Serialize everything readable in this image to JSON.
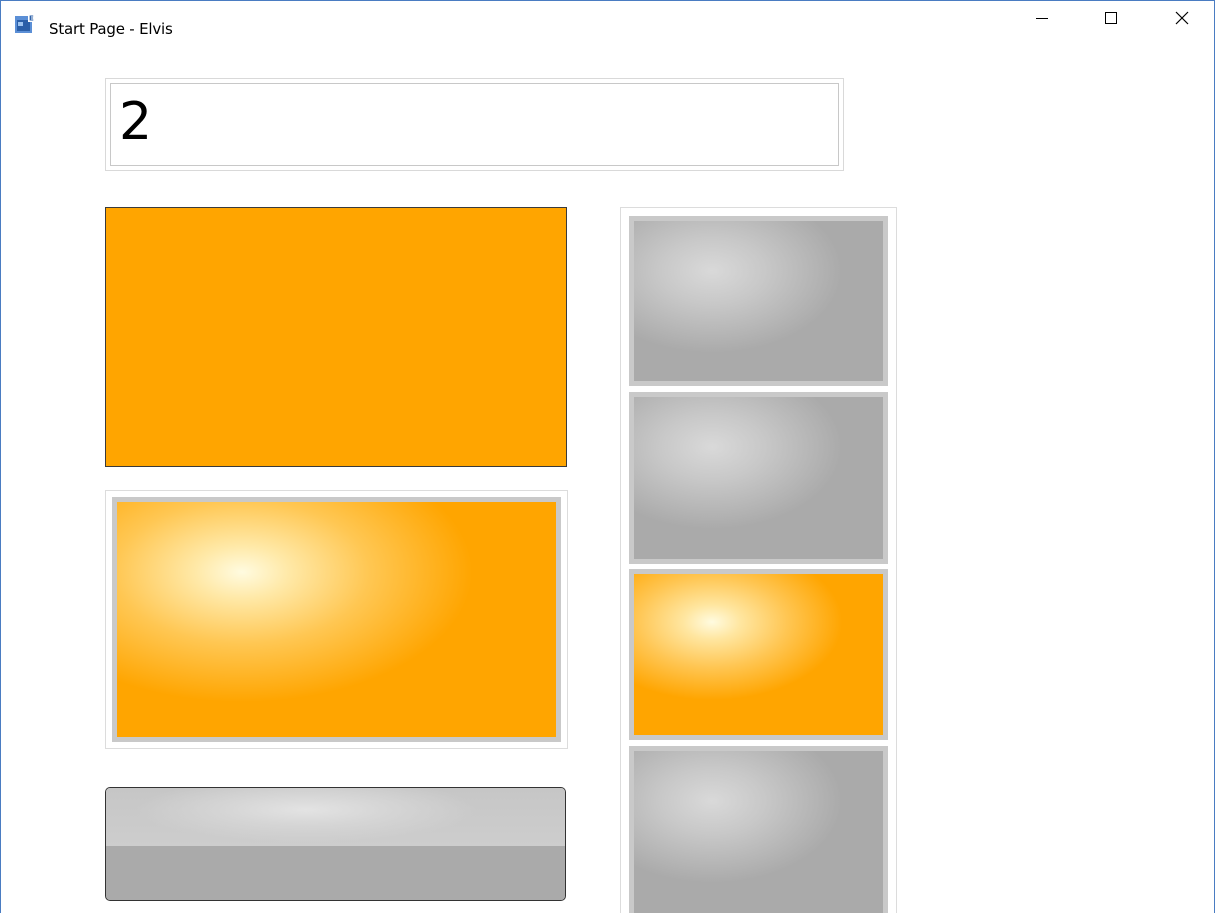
{
  "window": {
    "title": "Start Page - Elvis",
    "icon": "app-icon",
    "controls": {
      "minimize": "minimize-icon",
      "maximize": "maximize-icon",
      "close": "close-icon"
    }
  },
  "display": {
    "value": "2"
  },
  "colors": {
    "accent": "#ffa500",
    "tile_gray": "#aaaaaa",
    "tile_border": "#c9c9c9"
  },
  "tiles": {
    "main_selected": "orange",
    "side": [
      "gray",
      "gray",
      "orange",
      "gray"
    ]
  }
}
